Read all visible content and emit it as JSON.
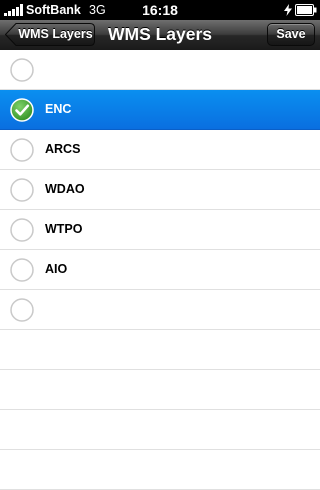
{
  "status_bar": {
    "carrier": "SoftBank",
    "network": "3G",
    "time": "16:18",
    "signal_icon": "signal-bars-icon",
    "battery_icon": "battery-charging-icon"
  },
  "nav": {
    "title": "WMS Layers",
    "back_label": "WMS Layers",
    "save_label": "Save"
  },
  "layers": [
    {
      "name": "",
      "selected": false
    },
    {
      "name": "ENC",
      "selected": true
    },
    {
      "name": "ARCS",
      "selected": false
    },
    {
      "name": "WDAO",
      "selected": false
    },
    {
      "name": "WTPO",
      "selected": false
    },
    {
      "name": "AIO",
      "selected": false
    },
    {
      "name": "",
      "selected": false
    }
  ],
  "colors": {
    "selection": "#0a7fe8",
    "checkmark": "#3aa12a"
  }
}
